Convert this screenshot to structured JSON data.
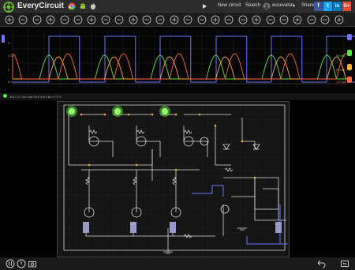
{
  "app": {
    "name": "EveryCircuit",
    "brand_color": "#6bd12a"
  },
  "header": {
    "nav": {
      "new_circuit": "New circuit",
      "search": "Search",
      "user": "eucevalun"
    },
    "share": {
      "label": "Share",
      "facebook": "f",
      "twitter": "t",
      "linkedin": "in",
      "google": "G+"
    }
  },
  "toolbar": {
    "tools": [
      "ground",
      "node",
      "resistor",
      "capacitor",
      "inductor",
      "voltage-source",
      "current-source",
      "diode",
      "led",
      "npn",
      "pnp",
      "nmos",
      "pmos",
      "switch",
      "wire",
      "play",
      "rotate",
      "flip",
      "delete",
      "more",
      "undo",
      "zoom-in",
      "zoom-out",
      "fit",
      "settings"
    ]
  },
  "scope": {
    "y_ticks": [
      "4",
      "2.5",
      "2",
      "0.4"
    ],
    "right_labels": [
      "29 mA",
      "20 mA",
      "1.6 mA"
    ],
    "channel_colors": [
      "#6e74ff",
      "#5de64a",
      "#ffb030",
      "#ff6a3a"
    ]
  },
  "infobar": {
    "status": "mA  1.27 mA   Isat  24.6 mA   Vbe  0.71 V"
  },
  "bottom": {
    "pause": "pause-icon",
    "record": "record-icon",
    "camera": "camera-icon",
    "undo": "undo-icon",
    "fullscreen": "fullscreen-icon"
  }
}
